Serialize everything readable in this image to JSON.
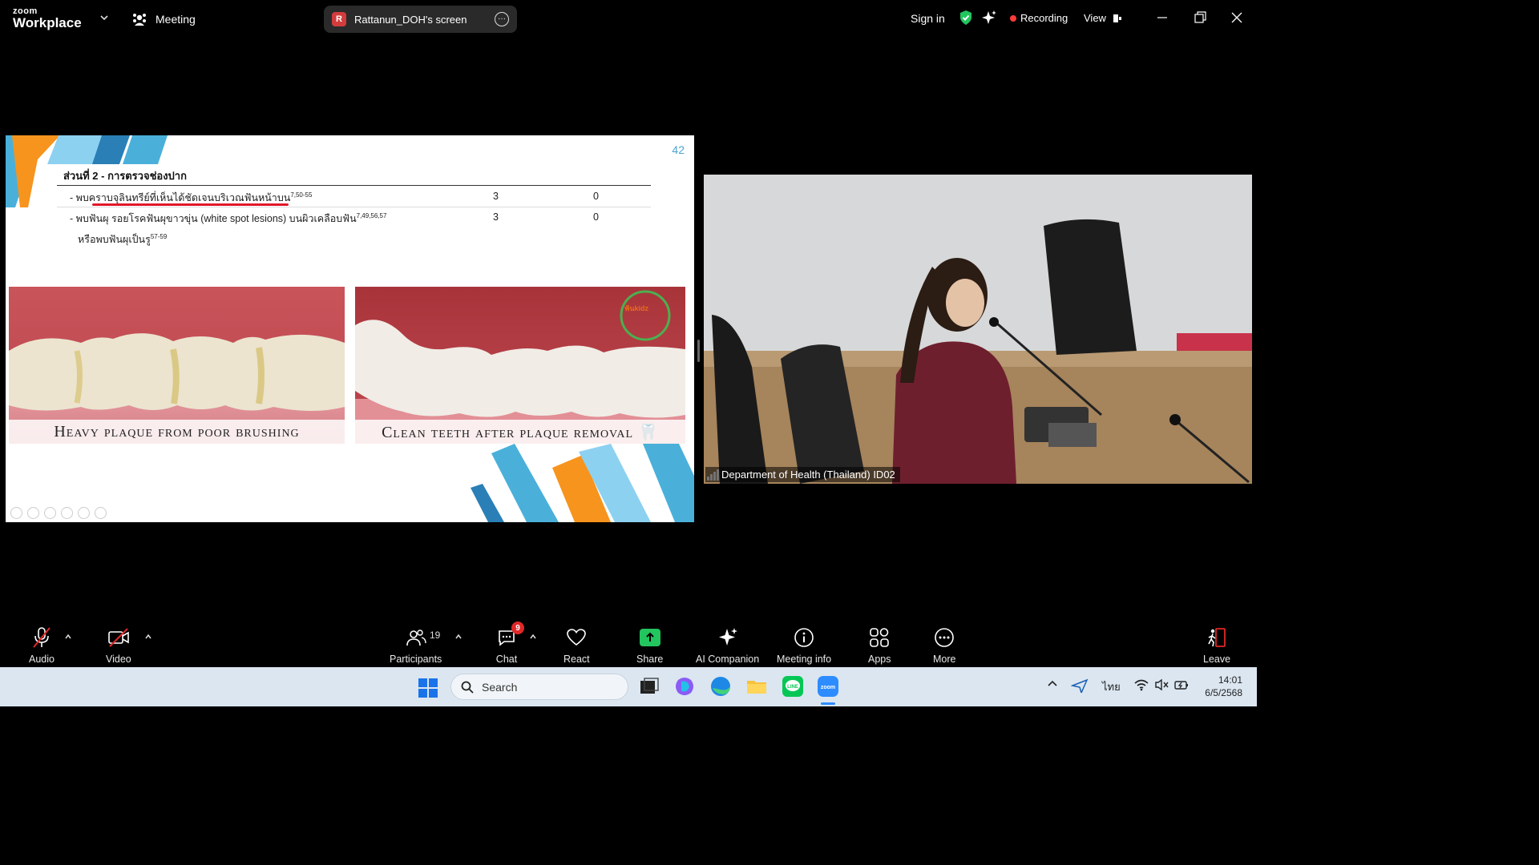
{
  "topbar": {
    "logo_small": "zoom",
    "logo_big": "Workplace",
    "meeting_label": "Meeting",
    "screen_badge": "R",
    "screen_label": "Rattanun_DOH's screen",
    "signin": "Sign in",
    "recording": "Recording",
    "view": "View"
  },
  "slide": {
    "page_number": "42",
    "heading": "ส่วนที่ 2 - การตรวจช่องปาก",
    "rows": [
      {
        "text": "- พบคราบจุลินทรีย์ที่เห็นได้ชัดเจนบริเวณฟันหน้าบน",
        "sup": "7,50-55",
        "col1": "3",
        "col2": "0"
      },
      {
        "text": "- พบฟันผุ รอยโรคฟันผุขาวขุ่น (white spot lesions) บนผิวเคลือบฟัน",
        "sup": "7,49,56,57",
        "col1": "3",
        "col2": "0"
      }
    ],
    "row2_cont": "หรือพบฟันผุเป็นรู",
    "row2_cont_sup": "57-59",
    "caption_left": "Heavy plaque from poor brushing",
    "caption_right": "Clean teeth after plaque removal 🦷",
    "watermark": "ฟันkidz"
  },
  "video": {
    "participant_name": "Department of Health (Thailand) ID02"
  },
  "toolbar": {
    "audio": "Audio",
    "video": "Video",
    "participants": "Participants",
    "participants_count": "19",
    "chat": "Chat",
    "chat_badge": "9",
    "react": "React",
    "share": "Share",
    "ai_companion": "AI Companion",
    "meeting_info": "Meeting info",
    "apps": "Apps",
    "more": "More",
    "leave": "Leave"
  },
  "taskbar": {
    "search_placeholder": "Search",
    "language": "ไทย",
    "time": "14:01",
    "date": "6/5/2568"
  },
  "colors": {
    "accent_green": "#22c55e",
    "recording_red": "#ff3b3b",
    "slide_blue": "#4ab0da",
    "slide_orange": "#f7941d"
  }
}
